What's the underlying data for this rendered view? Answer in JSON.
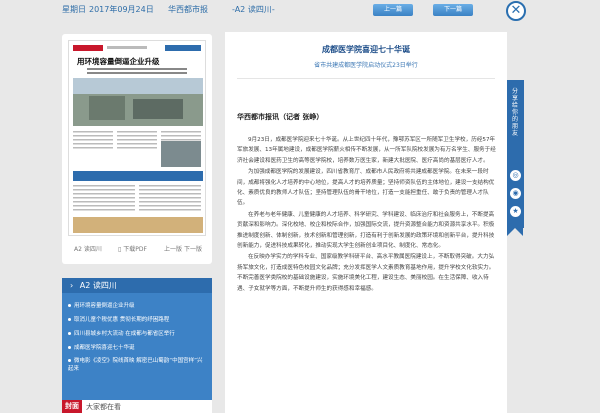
{
  "topbar": {
    "weekday": "星期日",
    "date": "2017年09月24日",
    "newspaper": "华西都市报",
    "edition": "-A2 读四川-",
    "prev_label": "上一篇",
    "next_label": "下一篇"
  },
  "thumbnail": {
    "masthead": "华西都市报",
    "section_label": "A2 读四川",
    "headline": "用环境容量倒逼企业升级",
    "edition_label": "A2 读四川",
    "pdf_label": "下载PDF",
    "prev_page": "上一版",
    "next_page": "下一版"
  },
  "section_list": {
    "header": "A2 读四川",
    "items": [
      "用环境容量倒逼企业升级",
      "取消儿童个税优惠 贯彻长期的纾困路程",
      "四川县城乡村大流动 在成都与都省区举行",
      "成都医学院喜迎七十华诞",
      "微电影《凌空》院线首映 解密巴山蜀韵“中国宫样”兴起来"
    ]
  },
  "cover_tab": {
    "label": "封面",
    "text": "大家都在看"
  },
  "article": {
    "title": "成都医学院喜迎七十华诞",
    "subtitle": "省市共建成都医学院启动仪式23日举行",
    "lead": "华西都市报讯（记者 张峥）",
    "paragraphs": [
      "9月23日，成都医学院迎来七十华诞。从上世纪四十年代，豫鄂苏军区一所随军卫生学校，历经57年军旅发展、13年属地建设，成都医学院薪火相传不断发展，从一所军队院校发展为有万名学生、服务于经济社会建设和医药卫生的高等医学院校，培养数万医生家，新建大批医院、医疗高尚的基层医疗人才。",
      "为加强成都医学院的发展建设，四川省教育厅、成都市人民政府将共建成都医学院。在未来一段时间，成都将强化人才培养的中心地位，提高人才的培养质量；坚持师资队伍的主体地位，建设一支结构优化、素质优良的教师人才队伍；坚持管理队伍的骨干地位，打造一支能担重任、敢于负责的管理人才队伍。",
      "在养老与老年健康、儿童健康的人才培养、科学研究、学科建设、临床治疗和社会服务上，不断提高贡献深和影响力。深化校地、校企和校际合作，加强国际交流，提升资源整合能力和资源共享水平。积极推进制度创新、体制创新，技术创新和管理创新，打造有利于创新发展的政策环境和创新平台，提升科技创新能力，促进科技成果转化，推动实现大学生创新创业项目化、制度化、常态化。",
      "在反映办学实力的学科专业、国家级教学科研平台、高水平教属医院建设上，不断取得突破。大力弘扬军旅文化，打造成医特色校园文化品牌；充分发挥医学人文素质教育基地作用，提升学校文化软实力。不断完善医学类院校的基础设施建设，实施环境美化工程，建设生态、美丽校园。在生活保障、收入待遇、子女就学等方面，不断提升师生的获得感和幸福感。"
    ]
  },
  "share": {
    "label": "分享给你的朋友",
    "icons": [
      "wechat-icon",
      "weibo-icon",
      "qzone-icon"
    ]
  }
}
